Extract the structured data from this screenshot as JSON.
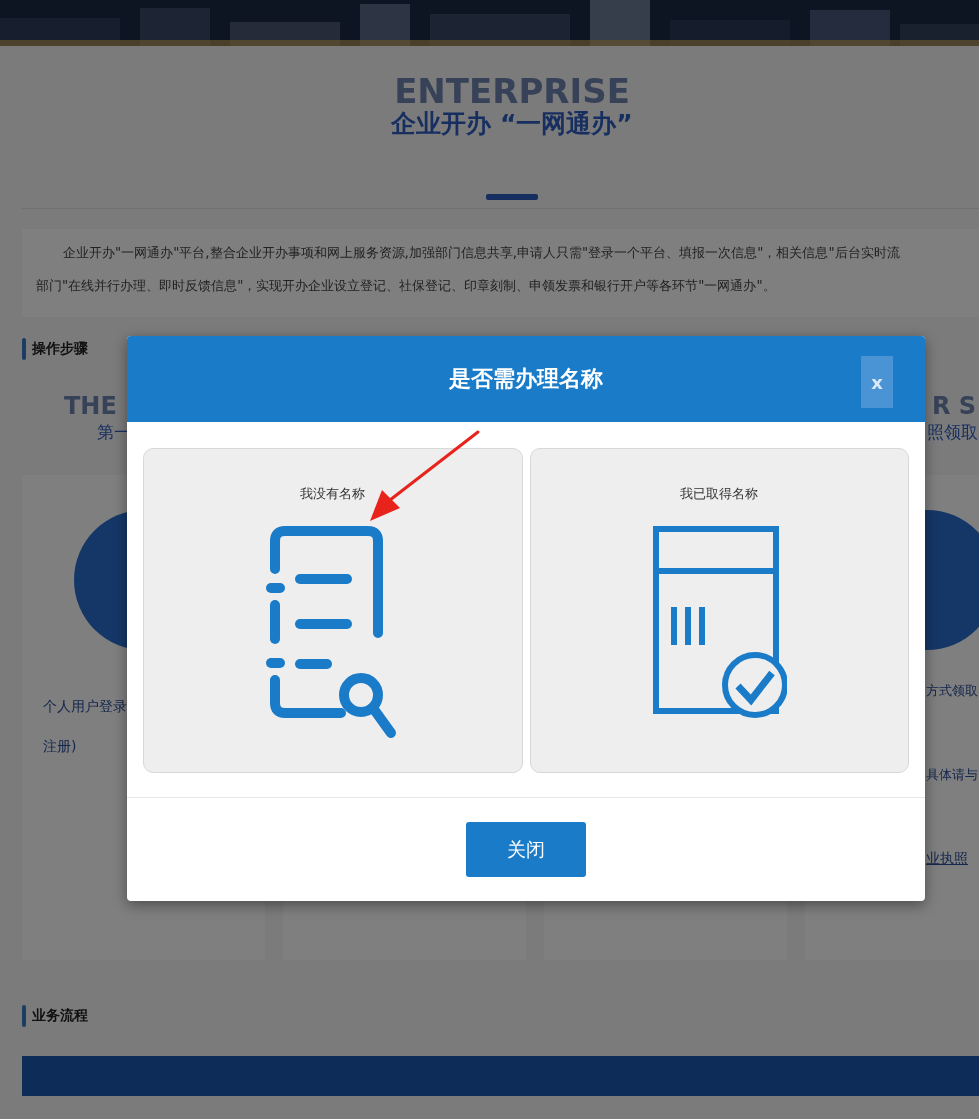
{
  "hero": {
    "background_text": "ENTERPRISE",
    "title": "企业开办 “一网通办”"
  },
  "intro": {
    "lines": [
      "企业开办\"一网通办\"平台,整合企业开办事项和网上服务资源,加强部门信息共享,申请人只需\"登录一个平台、填报一次信息\"，相关信息\"后台实时流",
      "部门\"在线并行办理、即时反馈信息\"，实现开办企业设立登记、社保登记、印章刻制、申领发票和银行开户等各环节\"一网通办\"。"
    ]
  },
  "steps": {
    "heading": "操作步骤",
    "columns": [
      {
        "kind": "step",
        "background_text": "THE",
        "label": "第一"
      },
      {
        "kind": "covered"
      },
      {
        "kind": "covered"
      },
      {
        "kind": "step",
        "background_text": "R S",
        "label": "照领取"
      }
    ],
    "cards": [
      {
        "kind": "step",
        "lines": [
          "个人用户登录",
          "注册)"
        ]
      },
      {
        "kind": "covered"
      },
      {
        "kind": "covered"
      },
      {
        "kind": "step",
        "lines": [
          "方式领取",
          "具体请与"
        ],
        "link": "业执照"
      }
    ]
  },
  "flow": {
    "heading": "业务流程"
  },
  "modal": {
    "title": "是否需办理名称",
    "close_label": "x",
    "options": [
      {
        "label": "我没有名称",
        "kind": "search-document"
      },
      {
        "label": "我已取得名称",
        "kind": "calendar-check"
      }
    ],
    "close_button": "关闭"
  }
}
